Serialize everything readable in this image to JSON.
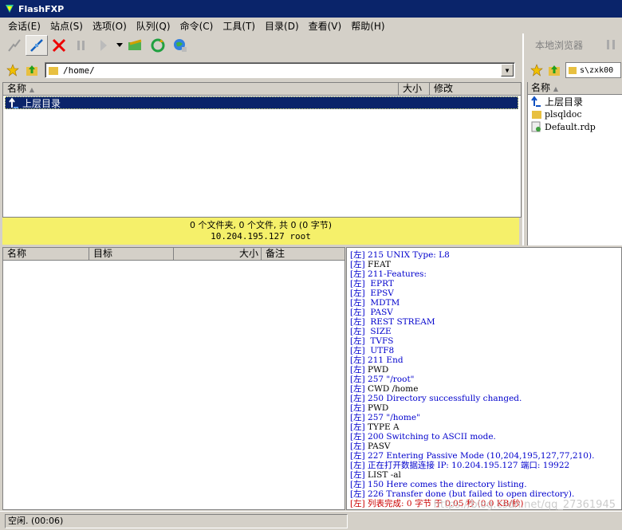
{
  "window": {
    "title": "FlashFXP"
  },
  "menu": [
    "会话(E)",
    "站点(S)",
    "选项(O)",
    "队列(Q)",
    "命令(C)",
    "工具(T)",
    "目录(D)",
    "查看(V)",
    "帮助(H)"
  ],
  "remote": {
    "path": "/home/",
    "columns": {
      "name": "名称",
      "size": "大小",
      "modified": "修改"
    },
    "rows": [
      {
        "name": "上层目录",
        "selected": true
      }
    ],
    "status_line1": "0 个文件夹, 0 个文件, 共 0 (0 字节)",
    "status_line2": "10.204.195.127 root"
  },
  "local": {
    "title": "本地浏览器",
    "path": "s\\zxk00",
    "column_name": "名称",
    "items": [
      {
        "name": "上层目录",
        "icon": "up-dir-icon"
      },
      {
        "name": "plsqldoc",
        "icon": "folder-icon"
      },
      {
        "name": "Default.rdp",
        "icon": "rdp-file-icon"
      }
    ]
  },
  "queue": {
    "columns": {
      "name": "名称",
      "target": "目标",
      "size": "大小",
      "note": "备注"
    }
  },
  "log": [
    {
      "tag": "[左]",
      "text": "215 UNIX Type: L8",
      "style": "blue"
    },
    {
      "tag": "[左]",
      "text": "FEAT",
      "style": "black"
    },
    {
      "tag": "[左]",
      "text": "211-Features:",
      "style": "blue"
    },
    {
      "tag": "[左]",
      "text": " EPRT",
      "style": "blue"
    },
    {
      "tag": "[左]",
      "text": " EPSV",
      "style": "blue"
    },
    {
      "tag": "[左]",
      "text": " MDTM",
      "style": "blue"
    },
    {
      "tag": "[左]",
      "text": " PASV",
      "style": "blue"
    },
    {
      "tag": "[左]",
      "text": " REST STREAM",
      "style": "blue"
    },
    {
      "tag": "[左]",
      "text": " SIZE",
      "style": "blue"
    },
    {
      "tag": "[左]",
      "text": " TVFS",
      "style": "blue"
    },
    {
      "tag": "[左]",
      "text": " UTF8",
      "style": "blue"
    },
    {
      "tag": "[左]",
      "text": "211 End",
      "style": "blue"
    },
    {
      "tag": "[左]",
      "text": "PWD",
      "style": "black"
    },
    {
      "tag": "[左]",
      "text": "257 \"/root\"",
      "style": "blue"
    },
    {
      "tag": "[左]",
      "text": "CWD /home",
      "style": "black"
    },
    {
      "tag": "[左]",
      "text": "250 Directory successfully changed.",
      "style": "blue"
    },
    {
      "tag": "[左]",
      "text": "PWD",
      "style": "black"
    },
    {
      "tag": "[左]",
      "text": "257 \"/home\"",
      "style": "blue"
    },
    {
      "tag": "[左]",
      "text": "TYPE A",
      "style": "black"
    },
    {
      "tag": "[左]",
      "text": "200 Switching to ASCII mode.",
      "style": "blue"
    },
    {
      "tag": "[左]",
      "text": "PASV",
      "style": "black"
    },
    {
      "tag": "[左]",
      "text": "227 Entering Passive Mode (10,204,195,127,77,210).",
      "style": "blue"
    },
    {
      "tag": "[左]",
      "text": "正在打开数据连接 IP: 10.204.195.127 端口: 19922",
      "style": "blue"
    },
    {
      "tag": "[左]",
      "text": "LIST -al",
      "style": "black"
    },
    {
      "tag": "[左]",
      "text": "150 Here comes the directory listing.",
      "style": "blue"
    },
    {
      "tag": "[左]",
      "text": "226 Transfer done (but failed to open directory).",
      "style": "blue"
    },
    {
      "tag": "[左]",
      "text": "列表完成: 0 字节 于 0.05 秒 (0.0 KB/秒)",
      "style": "red"
    }
  ],
  "statusbar": {
    "text": "空闲.  (00:06)"
  },
  "watermark": "https://blog.csdn.net/qq_27361945",
  "colors": {
    "title_bg": "#0a246a",
    "status_yellow": "#f5f06a",
    "log_blue": "#0000cc",
    "log_red": "#cc0000"
  }
}
